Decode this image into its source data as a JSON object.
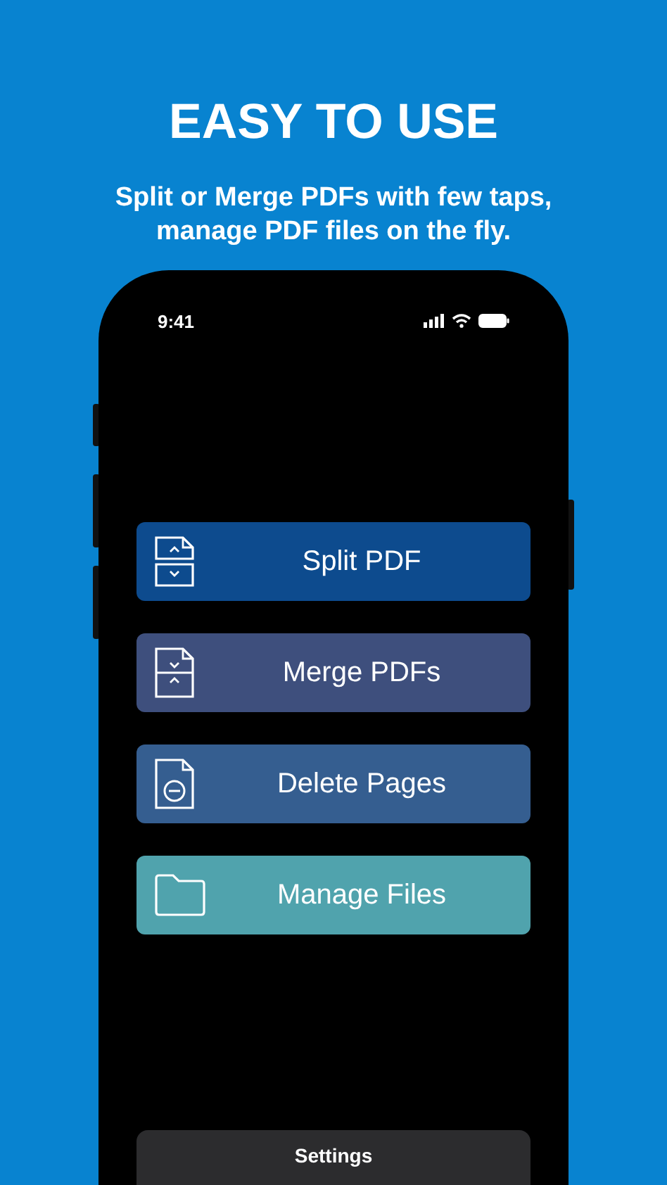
{
  "headline": "EASY TO USE",
  "subtitle": [
    "Split or Merge PDFs with few taps,",
    "manage PDF files on the fly."
  ],
  "status_bar": {
    "time": "9:41"
  },
  "actions": [
    {
      "label": "Split PDF",
      "kind": "split",
      "color": "#0d4b8e"
    },
    {
      "label": "Merge PDFs",
      "kind": "merge",
      "color": "#3e4f7d"
    },
    {
      "label": "Delete Pages",
      "kind": "delete",
      "color": "#355e90"
    },
    {
      "label": "Manage Files",
      "kind": "folder",
      "color": "#50a3ad"
    }
  ],
  "settings_button": "Settings"
}
